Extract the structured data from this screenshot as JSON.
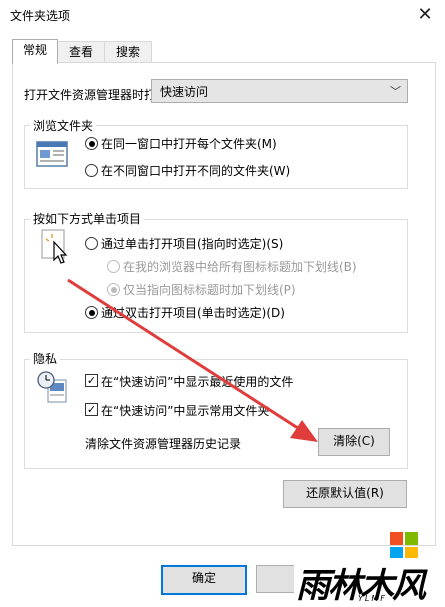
{
  "window": {
    "title": "文件夹选项"
  },
  "tabs": [
    {
      "label": "常规"
    },
    {
      "label": "查看"
    },
    {
      "label": "搜索"
    }
  ],
  "general": {
    "open_explorer_label": "打开文件资源管理器时打",
    "open_explorer_value": "快速访问"
  },
  "browse": {
    "title": "浏览文件夹",
    "options": [
      {
        "label": "在同一窗口中打开每个文件夹(M)",
        "checked": true
      },
      {
        "label": "在不同窗口中打开不同的文件夹(W)",
        "checked": false
      }
    ]
  },
  "click": {
    "title": "按如下方式单击项目",
    "single_click": "通过单击打开项目(指向时选定)(S)",
    "underline_all": "在我的浏览器中给所有图标标题加下划线(B)",
    "underline_hover": "仅当指向图标标题时加下划线(P)",
    "double_click": "通过双击打开项目(单击时选定)(D)"
  },
  "privacy": {
    "title": "隐私",
    "show_recent": "在“快速访问”中显示最近使用的文件",
    "show_frequent": "在“快速访问”中显示常用文件夹",
    "clear_label": "清除文件资源管理器历史记录",
    "clear_button": "清除(C)"
  },
  "restore_button": "还原默认值(R)",
  "footer": {
    "ok_button": "确定"
  },
  "watermark": {
    "text": "雨林木风",
    "sub": "YLMF"
  },
  "colors": {
    "accent": "#0078d7",
    "arrow": "#e03c3c"
  }
}
